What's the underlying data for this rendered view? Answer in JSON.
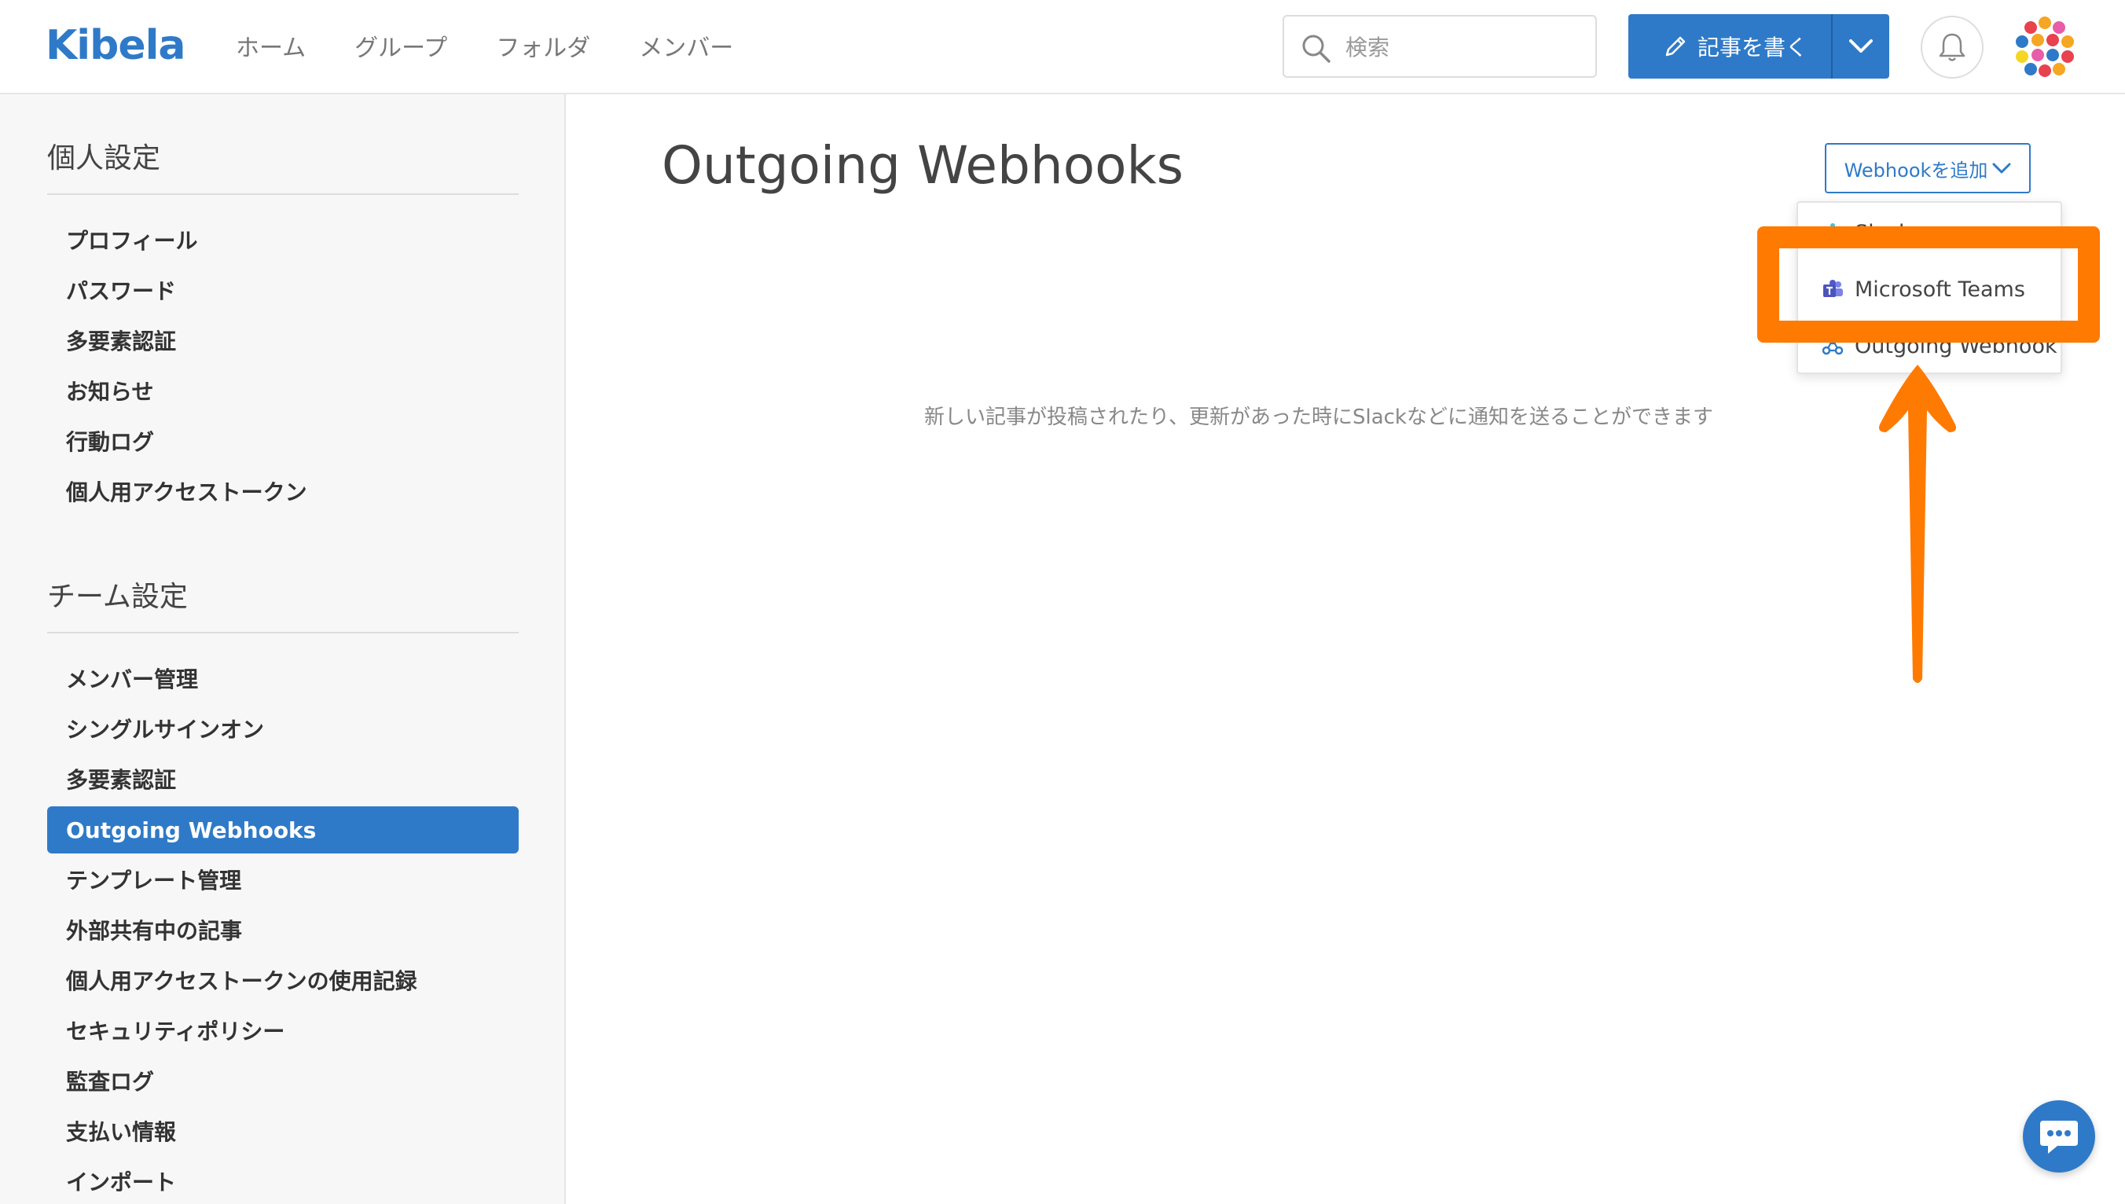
{
  "header": {
    "logo": "Kibela",
    "nav": [
      "ホーム",
      "グループ",
      "フォルダ",
      "メンバー"
    ],
    "search_placeholder": "検索",
    "write_label": "記事を書く"
  },
  "sidebar": {
    "personal_title": "個人設定",
    "personal_items": [
      "プロフィール",
      "パスワード",
      "多要素認証",
      "お知らせ",
      "行動ログ",
      "個人用アクセストークン"
    ],
    "team_title": "チーム設定",
    "team_items": [
      "メンバー管理",
      "シングルサインオン",
      "多要素認証",
      "Outgoing Webhooks",
      "テンプレート管理",
      "外部共有中の記事",
      "個人用アクセストークンの使用記録",
      "セキュリティポリシー",
      "監査ログ",
      "支払い情報",
      "インポート"
    ],
    "active_item": "Outgoing Webhooks"
  },
  "main": {
    "title": "Outgoing Webhooks",
    "add_button": "Webhookを追加",
    "dropdown": [
      "Slack",
      "Microsoft Teams",
      "Outgoing Webhook"
    ],
    "description": "新しい記事が投稿されたり、更新があった時にSlackなどに通知を送ることができます"
  },
  "colors": {
    "brand": "#2f7ac8",
    "annotation": "#ff7a00"
  }
}
